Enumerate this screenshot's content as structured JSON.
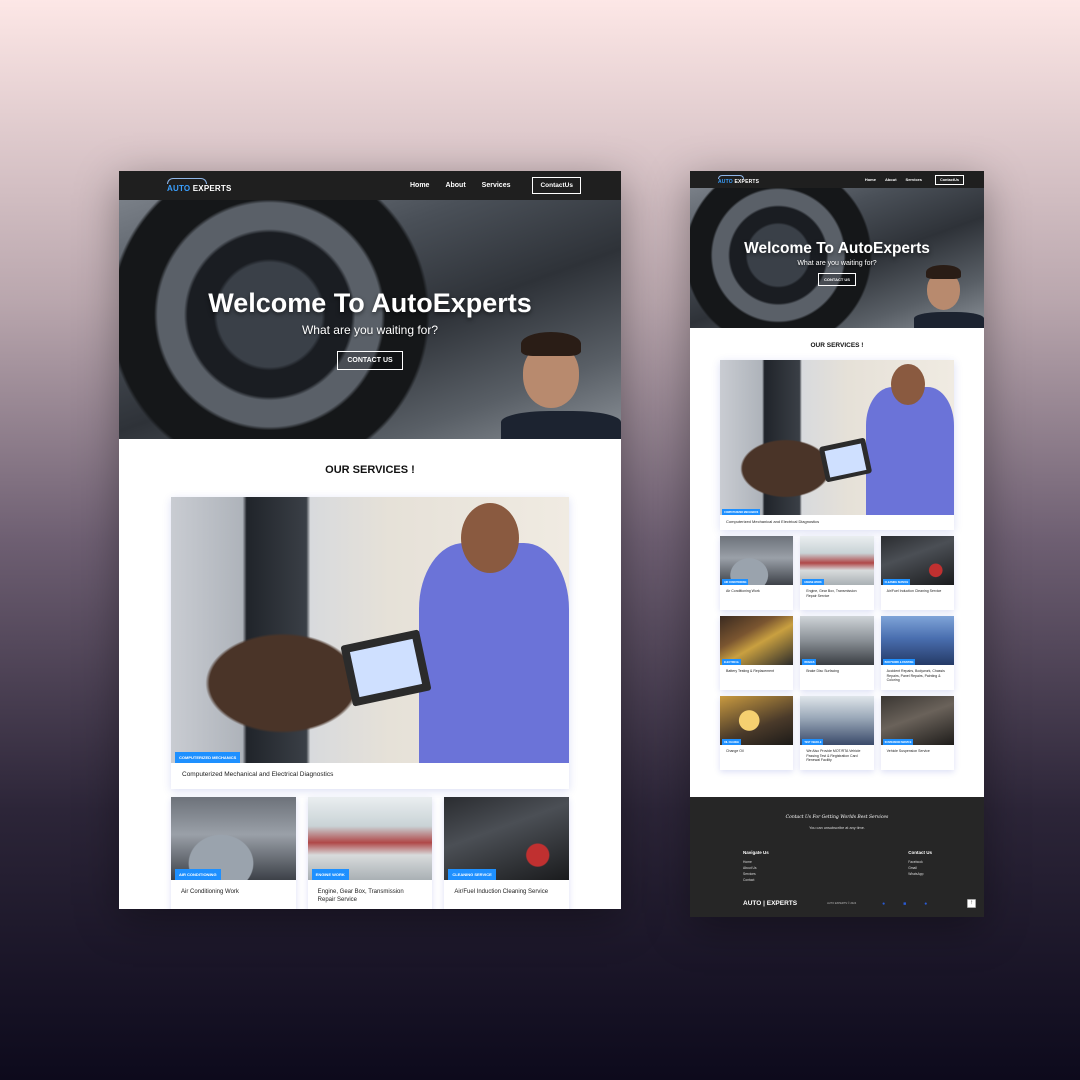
{
  "brand": {
    "logo_auto": "AUTO",
    "logo_experts": "EXPERTS"
  },
  "nav": {
    "items": [
      "Home",
      "About",
      "Services"
    ],
    "contact": "ContactUs"
  },
  "hero": {
    "title": "Welcome To AutoExperts",
    "subtitle": "What are you waiting for?",
    "button": "CONTACT US"
  },
  "services": {
    "title": "OUR SERVICES !",
    "featured": {
      "badge": "COMPUTERIZED MECHANICS",
      "caption": "Computerized Mechanical and Electrical Diagnostics"
    },
    "cards": [
      {
        "badge": "AIR CONDITIONING",
        "caption": "Air Conditioning Work"
      },
      {
        "badge": "Engine Work",
        "caption": "Engine, Gear Box, Transmission Repair Service"
      },
      {
        "badge": "CLEANING SERVICE",
        "caption": "Air/Fuel Induction Cleaning Service"
      },
      {
        "badge": "ELECTRICAL",
        "caption": "Battery Testing & Replacement"
      },
      {
        "badge": "BRAKES",
        "caption": "Brake Disc Surfacing"
      },
      {
        "badge": "BODYWORK & PAINTING",
        "caption": "Accident Repairs, Bodywork, Chassis Repairs, Panel Repairs, Painting & Coloring"
      },
      {
        "badge": "OIL CHANGE",
        "caption": "Change Oil"
      },
      {
        "badge": "TEST VEHICLE",
        "caption": "We Also Provide MOT/RTA Vehicle Passing Test & Registration Card Renewal Facility"
      },
      {
        "badge": "SUSPENSION SERVICE",
        "caption": "Vehicle Suspension Service"
      }
    ]
  },
  "footer": {
    "title": "Contact Us For Getting Worlds Best Services",
    "subtitle": "You can unsubscribe at any time.",
    "navigate_heading": "Navigate Us",
    "navigate_links": [
      "Home",
      "About Us",
      "Services",
      "Contact"
    ],
    "contact_heading": "Contact Us",
    "contact_links": [
      "Facebook",
      "Gmail",
      "WhatsApp"
    ],
    "logo": "AUTO | EXPERTS",
    "copyright": "AUTO EXPERTS © 2024",
    "social_icons": [
      "facebook-icon",
      "mail-icon",
      "whatsapp-icon"
    ],
    "to_top": "↑"
  }
}
